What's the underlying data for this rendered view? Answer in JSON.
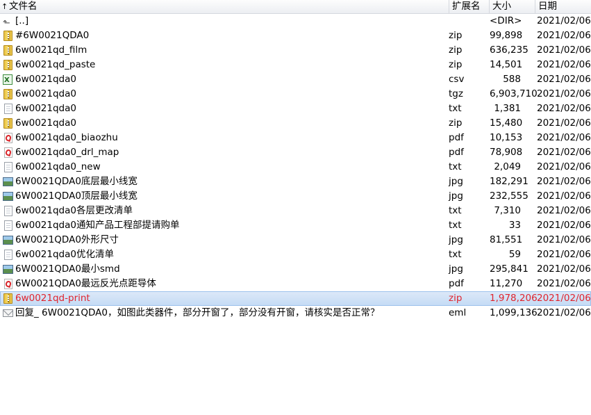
{
  "header": {
    "sort_indicator": "↑",
    "name_label": "文件名",
    "ext_label": "扩展名",
    "size_label": "大小",
    "date_label": "日期"
  },
  "rows": [
    {
      "icon": "up-folder-icon",
      "name": "[..]",
      "ext": "",
      "size": "<DIR>",
      "date": "2021/02/06"
    },
    {
      "icon": "archive-icon",
      "name": "#6W0021QDA0",
      "ext": "zip",
      "size": "99,898",
      "date": "2021/02/06"
    },
    {
      "icon": "archive-icon",
      "name": "6w0021qd_film",
      "ext": "zip",
      "size": "636,235",
      "date": "2021/02/06"
    },
    {
      "icon": "archive-icon",
      "name": "6w0021qd_paste",
      "ext": "zip",
      "size": "14,501",
      "date": "2021/02/06"
    },
    {
      "icon": "spreadsheet-icon",
      "name": "6w0021qda0",
      "ext": "csv",
      "size": "588",
      "date": "2021/02/06"
    },
    {
      "icon": "archive-icon",
      "name": "6w0021qda0",
      "ext": "tgz",
      "size": "6,903,710",
      "date": "2021/02/06"
    },
    {
      "icon": "text-file-icon",
      "name": "6w0021qda0",
      "ext": "txt",
      "size": "1,381",
      "date": "2021/02/06"
    },
    {
      "icon": "archive-icon",
      "name": "6w0021qda0",
      "ext": "zip",
      "size": "15,480",
      "date": "2021/02/06"
    },
    {
      "icon": "pdf-icon",
      "name": "6w0021qda0_biaozhu",
      "ext": "pdf",
      "size": "10,153",
      "date": "2021/02/06"
    },
    {
      "icon": "pdf-icon",
      "name": "6w0021qda0_drl_map",
      "ext": "pdf",
      "size": "78,908",
      "date": "2021/02/06"
    },
    {
      "icon": "text-file-icon",
      "name": "6w0021qda0_new",
      "ext": "txt",
      "size": "2,049",
      "date": "2021/02/06"
    },
    {
      "icon": "image-icon",
      "name": "6W0021QDA0底层最小线宽",
      "ext": "jpg",
      "size": "182,291",
      "date": "2021/02/06"
    },
    {
      "icon": "image-icon",
      "name": "6W0021QDA0顶层最小线宽",
      "ext": "jpg",
      "size": "232,555",
      "date": "2021/02/06"
    },
    {
      "icon": "text-file-icon",
      "name": "6w0021qda0各层更改清单",
      "ext": "txt",
      "size": "7,310",
      "date": "2021/02/06"
    },
    {
      "icon": "text-file-icon",
      "name": "6w0021qda0通知产品工程部提请购单",
      "ext": "txt",
      "size": "33",
      "date": "2021/02/06"
    },
    {
      "icon": "image-icon",
      "name": "6W0021QDA0外形尺寸",
      "ext": "jpg",
      "size": "81,551",
      "date": "2021/02/06"
    },
    {
      "icon": "text-file-icon",
      "name": "6w0021qda0优化清单",
      "ext": "txt",
      "size": "59",
      "date": "2021/02/06"
    },
    {
      "icon": "image-icon",
      "name": "6W0021QDA0最小smd",
      "ext": "jpg",
      "size": "295,841",
      "date": "2021/02/06"
    },
    {
      "icon": "pdf-icon",
      "name": "6W0021QDA0最远反光点距导体",
      "ext": "pdf",
      "size": "11,270",
      "date": "2021/02/06"
    },
    {
      "icon": "archive-icon",
      "name": "6w0021qd-print",
      "ext": "zip",
      "size": "1,978,206",
      "date": "2021/02/06",
      "selected": true
    },
    {
      "icon": "mail-icon",
      "name": "回复_ 6W0021QDA0，如图此类器件，部分开窗了，部分没有开窗，请核实是否正常？",
      "ext": "eml",
      "size": "1,099,136",
      "date": "2021/02/06"
    }
  ],
  "colors": {
    "selected_text": "#e0242e",
    "selected_bg": "#c4dbf5"
  }
}
